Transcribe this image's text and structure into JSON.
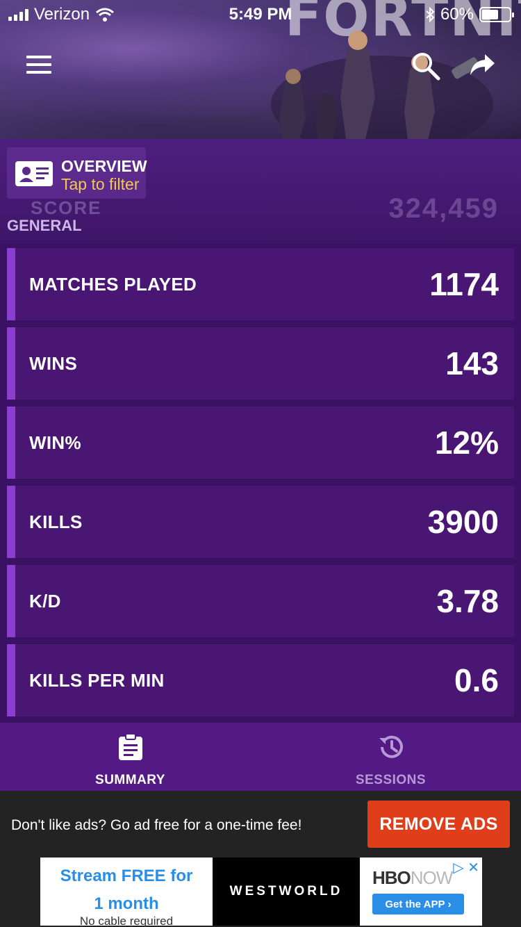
{
  "status_bar": {
    "carrier": "Verizon",
    "time": "5:49 PM",
    "battery": "60%",
    "battery_level": 0.6
  },
  "hero": {
    "title": "FORTNITE"
  },
  "overview": {
    "title": "OVERVIEW",
    "subtitle": "Tap to filter"
  },
  "faded_row": {
    "label": "SCORE",
    "value": "324,459"
  },
  "section": {
    "label": "GENERAL"
  },
  "stats": [
    {
      "label": "MATCHES PLAYED",
      "value": "1174"
    },
    {
      "label": "WINS",
      "value": "143"
    },
    {
      "label": "WIN%",
      "value": "12%"
    },
    {
      "label": "KILLS",
      "value": "3900"
    },
    {
      "label": "K/D",
      "value": "3.78"
    },
    {
      "label": "KILLS PER MIN",
      "value": "0.6"
    }
  ],
  "bottom_nav": {
    "summary": "SUMMARY",
    "sessions": "SESSIONS",
    "active": "summary"
  },
  "ad_bar": {
    "message": "Don't like ads? Go ad free for a one-time fee!",
    "remove_button": "REMOVE ADS",
    "banner": {
      "headline_1": "Stream FREE for",
      "headline_2": "1 month",
      "subline": "No cable required",
      "show": "WESTWORLD",
      "brand_1": "HBO",
      "brand_2": "NOW",
      "cta": "Get the APP"
    }
  },
  "colors": {
    "accent": "#8a3fd0",
    "card": "#4a1674",
    "remove_ads": "#e03e1a",
    "filter_text": "#f2c94c"
  }
}
